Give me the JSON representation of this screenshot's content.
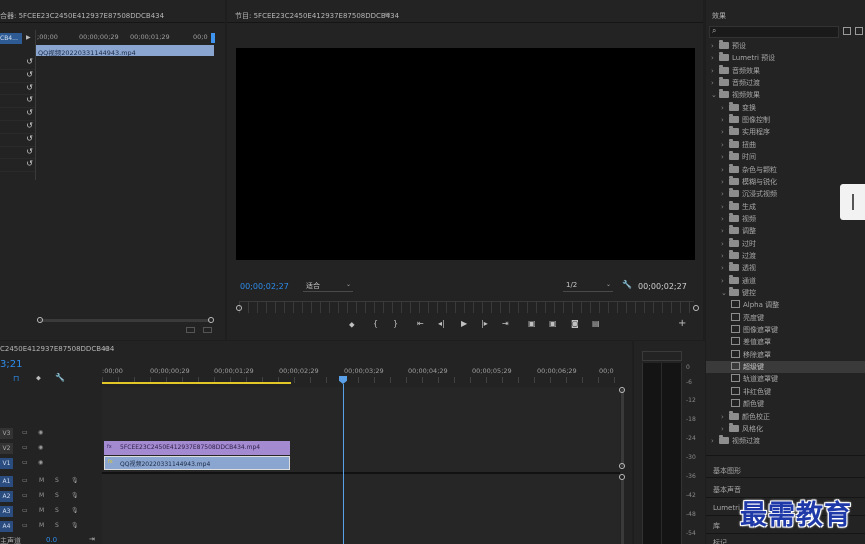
{
  "source": {
    "title": "合器: 5FCEE23C2450E412937E87508DDCB434",
    "seq_label": "CB4...",
    "timecodes": [
      ";00;00",
      "00;00;00;29",
      "00;00;01;29",
      "00;0"
    ],
    "clip_name": "QQ视频20220331144943.mp4"
  },
  "program": {
    "title": "节目: 5FCEE23C2450E412937E87508DDCB434",
    "timecode": "00;00;02;27",
    "fit": "适合",
    "resolution": "1/2",
    "duration": "00;00;02;27"
  },
  "timeline": {
    "title": "C2450E412937E87508DDCB434",
    "timecode": "3;21",
    "ruler": [
      ":00;00",
      "00;00;00;29",
      "00;00;01;29",
      "00;00;02;29",
      "00;00;03;29",
      "00;00;04;29",
      "00;00;05;29",
      "00;00;06;29",
      "00;0"
    ],
    "video_tracks": [
      "V3",
      "V2",
      "V1"
    ],
    "audio_tracks": [
      "A1",
      "A2",
      "A3",
      "A4"
    ],
    "master_label": "主声道",
    "master_value": "0.0",
    "clip_v2": "5FCEE23C2450E412937E87508DDCB434.mp4",
    "clip_v1": "QQ视频20220331144943.mp4",
    "mute": "M",
    "solo": "S"
  },
  "meter": {
    "ticks": [
      "0",
      "-6",
      "-12",
      "-18",
      "-24",
      "-30",
      "-36",
      "-42",
      "-48",
      "-54"
    ]
  },
  "effects": {
    "title": "效果",
    "items": [
      {
        "label": "预设",
        "level": 0,
        "state": "closed"
      },
      {
        "label": "Lumetri 预设",
        "level": 0,
        "state": "closed"
      },
      {
        "label": "音频效果",
        "level": 0,
        "state": "closed"
      },
      {
        "label": "音频过渡",
        "level": 0,
        "state": "closed"
      },
      {
        "label": "视频效果",
        "level": 0,
        "state": "open"
      },
      {
        "label": "变换",
        "level": 1,
        "state": "closed"
      },
      {
        "label": "图像控制",
        "level": 1,
        "state": "closed"
      },
      {
        "label": "实用程序",
        "level": 1,
        "state": "closed"
      },
      {
        "label": "扭曲",
        "level": 1,
        "state": "closed"
      },
      {
        "label": "时间",
        "level": 1,
        "state": "closed"
      },
      {
        "label": "杂色与颗粒",
        "level": 1,
        "state": "closed"
      },
      {
        "label": "模糊与锐化",
        "level": 1,
        "state": "closed"
      },
      {
        "label": "沉浸式视频",
        "level": 1,
        "state": "closed"
      },
      {
        "label": "生成",
        "level": 1,
        "state": "closed"
      },
      {
        "label": "视频",
        "level": 1,
        "state": "closed"
      },
      {
        "label": "调整",
        "level": 1,
        "state": "closed"
      },
      {
        "label": "过时",
        "level": 1,
        "state": "closed"
      },
      {
        "label": "过渡",
        "level": 1,
        "state": "closed"
      },
      {
        "label": "透视",
        "level": 1,
        "state": "closed"
      },
      {
        "label": "通道",
        "level": 1,
        "state": "closed"
      },
      {
        "label": "键控",
        "level": 1,
        "state": "open"
      },
      {
        "label": "Alpha 调整",
        "level": 2,
        "state": "fx"
      },
      {
        "label": "亮度键",
        "level": 2,
        "state": "fx"
      },
      {
        "label": "图像遮罩键",
        "level": 2,
        "state": "fx"
      },
      {
        "label": "差值遮罩",
        "level": 2,
        "state": "fx"
      },
      {
        "label": "移除遮罩",
        "level": 2,
        "state": "fx"
      },
      {
        "label": "超级键",
        "level": 2,
        "state": "fx",
        "selected": true
      },
      {
        "label": "轨道遮罩键",
        "level": 2,
        "state": "fx"
      },
      {
        "label": "非红色键",
        "level": 2,
        "state": "fx"
      },
      {
        "label": "颜色键",
        "level": 2,
        "state": "fx"
      },
      {
        "label": "颜色校正",
        "level": 1,
        "state": "closed"
      },
      {
        "label": "风格化",
        "level": 1,
        "state": "closed"
      },
      {
        "label": "视频过渡",
        "level": 0,
        "state": "closed"
      }
    ],
    "bottom_panels": [
      "基本图形",
      "基本声音",
      "Lumetri",
      "库",
      "标记"
    ]
  },
  "watermark": "最需教育",
  "colors": {
    "accent": "#2d8ceb",
    "clip_blue": "#8aa5cf",
    "clip_purple": "#a48ad0",
    "playhead": "#5aa0e8",
    "work_area": "#e3c729"
  }
}
